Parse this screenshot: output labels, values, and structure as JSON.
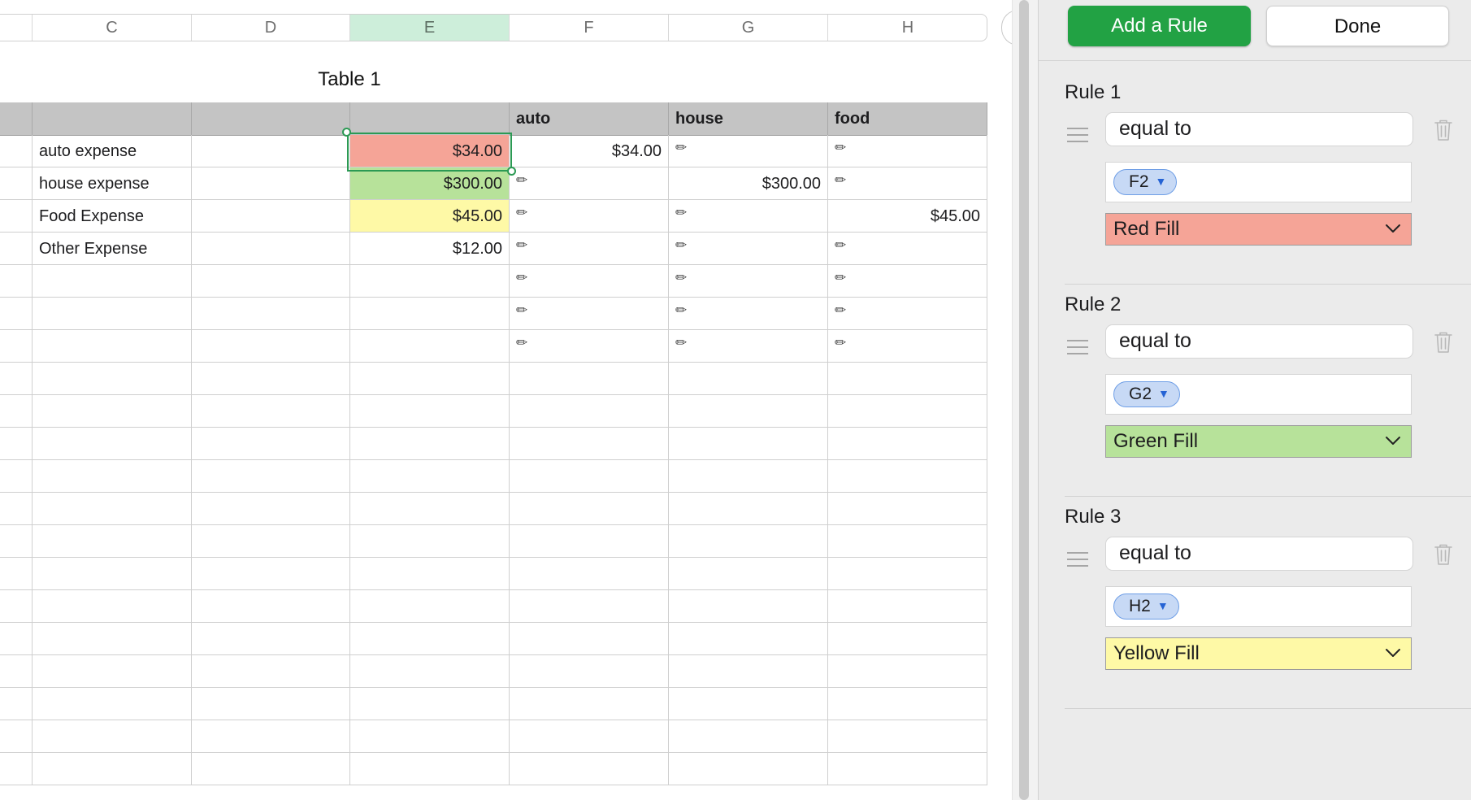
{
  "sheet": {
    "columns": [
      "C",
      "D",
      "E",
      "F",
      "G",
      "H"
    ],
    "selected_column": "E",
    "table_title": "Table 1",
    "header_row": [
      "",
      "",
      "",
      "auto",
      "house",
      "food"
    ],
    "rows": [
      [
        "auto expense",
        "",
        "$34.00",
        "$34.00",
        "✏",
        "✏"
      ],
      [
        "house expense",
        "",
        "$300.00",
        "✏",
        "$300.00",
        "✏"
      ],
      [
        "Food Expense",
        "",
        "$45.00",
        "✏",
        "✏",
        "$45.00"
      ],
      [
        "Other Expense",
        "",
        "$12.00",
        "✏",
        "✏",
        "✏"
      ],
      [
        "",
        "",
        "",
        "✏",
        "✏",
        "✏"
      ],
      [
        "",
        "",
        "",
        "✏",
        "✏",
        "✏"
      ],
      [
        "",
        "",
        "",
        "✏",
        "✏",
        "✏"
      ]
    ],
    "cell_fills": {
      "0": "#f5a497",
      "1": "#b7e29a",
      "2": "#fef9a6"
    },
    "selection_color": "#2c9a54"
  },
  "panel": {
    "add_rule_label": "Add a Rule",
    "done_label": "Done",
    "accent": "#22a244",
    "rules": [
      {
        "title": "Rule 1",
        "condition": "equal to",
        "reference": "F2",
        "fill": "Red Fill",
        "fill_color": "#f5a497"
      },
      {
        "title": "Rule 2",
        "condition": "equal to",
        "reference": "G2",
        "fill": "Green Fill",
        "fill_color": "#b7e29a"
      },
      {
        "title": "Rule 3",
        "condition": "equal to",
        "reference": "H2",
        "fill": "Yellow Fill",
        "fill_color": "#fef9a6"
      }
    ]
  }
}
